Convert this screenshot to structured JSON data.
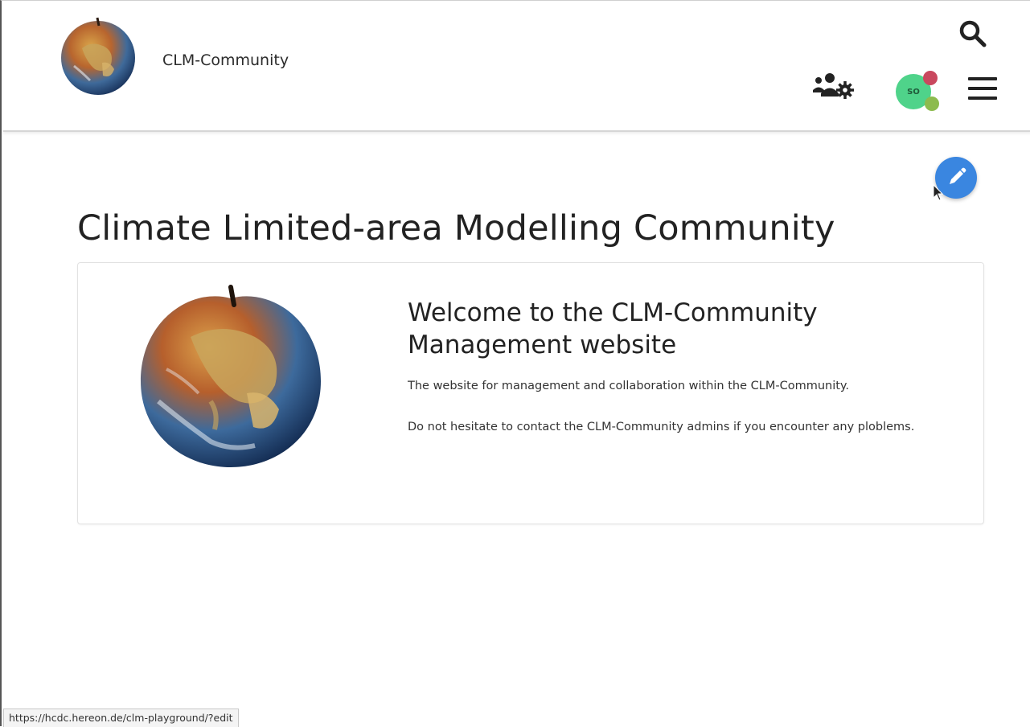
{
  "header": {
    "brand_name": "CLM-Community",
    "logo_icon": "apple-earth-logo",
    "search_icon": "search-icon",
    "groups_icon": "users-cog-icon",
    "avatar_initials": "SO",
    "menu_icon": "hamburger-menu-icon"
  },
  "actions": {
    "edit_icon": "pencil-icon"
  },
  "main": {
    "title": "Climate Limited-area Modelling Community",
    "card": {
      "image_icon": "apple-earth-image",
      "heading": "Welcome to the CLM-Community Management website",
      "paragraph_1": "The website for management and collaboration within the CLM-Community.",
      "paragraph_2": "Do not hesitate to contact the CLM-Community admins if you encounter any ploblems."
    }
  },
  "status_bar": {
    "url": "https://hcdc.hereon.de/clm-playground/?edit"
  },
  "colors": {
    "edit_button": "#3a86e0",
    "avatar_bg": "#4fd38a",
    "avatar_dot_red": "#c9485e",
    "avatar_dot_green": "#8dbb4e"
  }
}
